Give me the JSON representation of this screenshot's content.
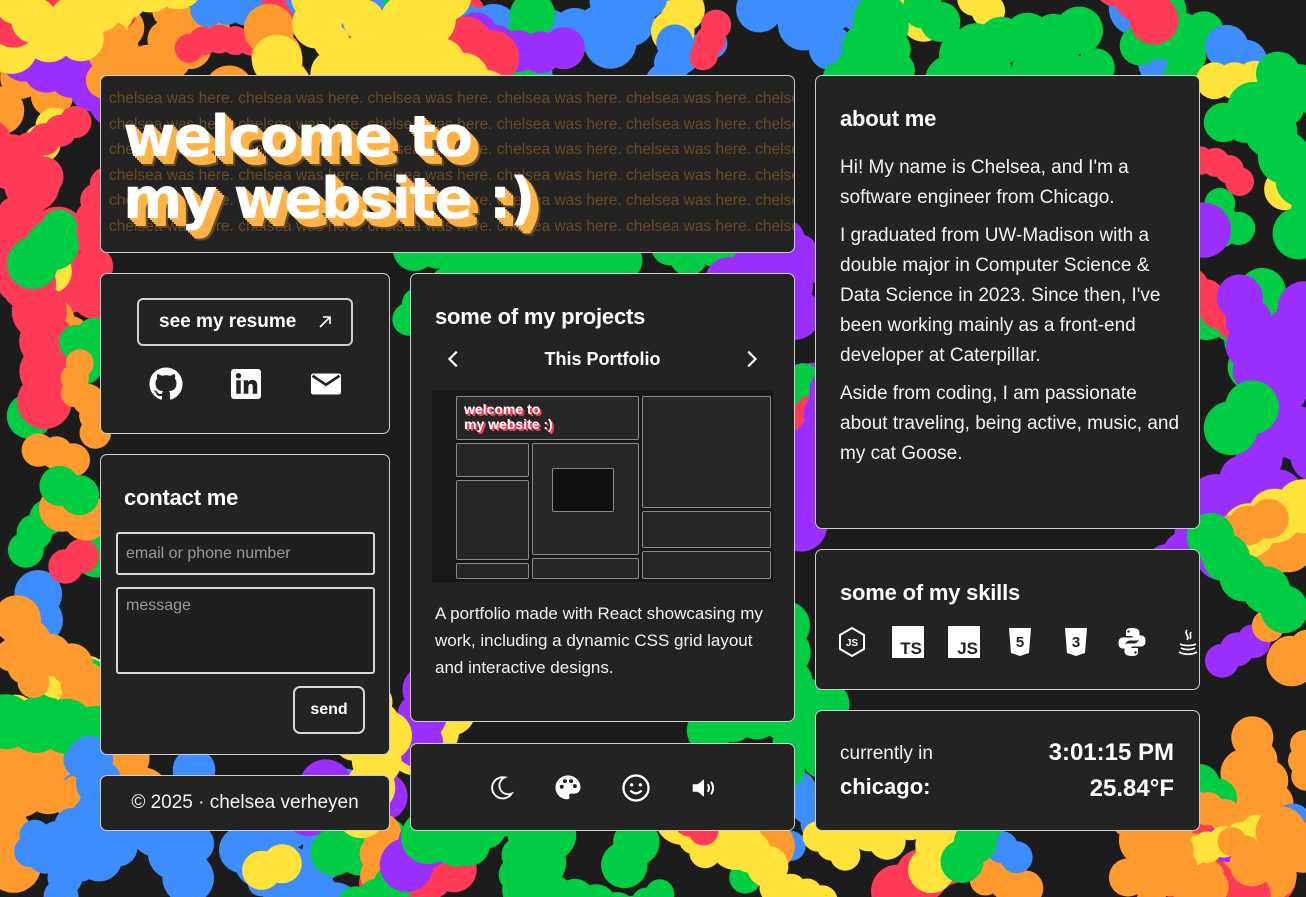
{
  "hero": {
    "watermark": "chelsea was here. chelsea was here. chelsea was here. chelsea was here. chelsea was here. chelsea was here.",
    "title_line1": "welcome to",
    "title_line2": "my website :)"
  },
  "links": {
    "resume_label": "see my resume",
    "icons": [
      "github-icon",
      "linkedin-icon",
      "mail-icon"
    ]
  },
  "contact": {
    "title": "contact me",
    "email_placeholder": "email or phone number",
    "message_placeholder": "message",
    "send_label": "send"
  },
  "footer": {
    "text": "© 2025 · chelsea verheyen"
  },
  "projects": {
    "title": "some of my projects",
    "current_name": "This Portfolio",
    "description": "A portfolio made with React showcasing my work, including a dynamic CSS grid layout and interactive designs."
  },
  "toggles": {
    "icons": [
      "moon-icon",
      "palette-icon",
      "smiley-icon",
      "volume-icon"
    ]
  },
  "about": {
    "title": "about me",
    "p1": "Hi! My name is Chelsea, and I'm a software engineer from Chicago.",
    "p2": "I graduated from UW-Madison with a double major in Computer Science & Data Science in 2023. Since then, I've been working mainly as a front-end developer at Caterpillar.",
    "p3": "Aside from coding, I am passionate about traveling, being active, music, and my cat Goose."
  },
  "skills": {
    "title": "some of my skills",
    "icons": [
      "nodejs-icon",
      "typescript-icon",
      "javascript-icon",
      "html5-icon",
      "css3-icon",
      "python-icon",
      "java-icon"
    ],
    "ts_text": "TS",
    "js_text": "JS"
  },
  "weather": {
    "label": "currently in",
    "city": "chicago:",
    "time": "3:01:15 PM",
    "temp": "25.84°F"
  },
  "colors": {
    "card_bg": "#232323",
    "page_bg": "#1c1c1c",
    "title_shadow": "#ffb347",
    "splash": [
      "#ff3b57",
      "#ff9a2e",
      "#ffe23a",
      "#00cc44",
      "#3d8dff",
      "#9b2fff"
    ]
  }
}
